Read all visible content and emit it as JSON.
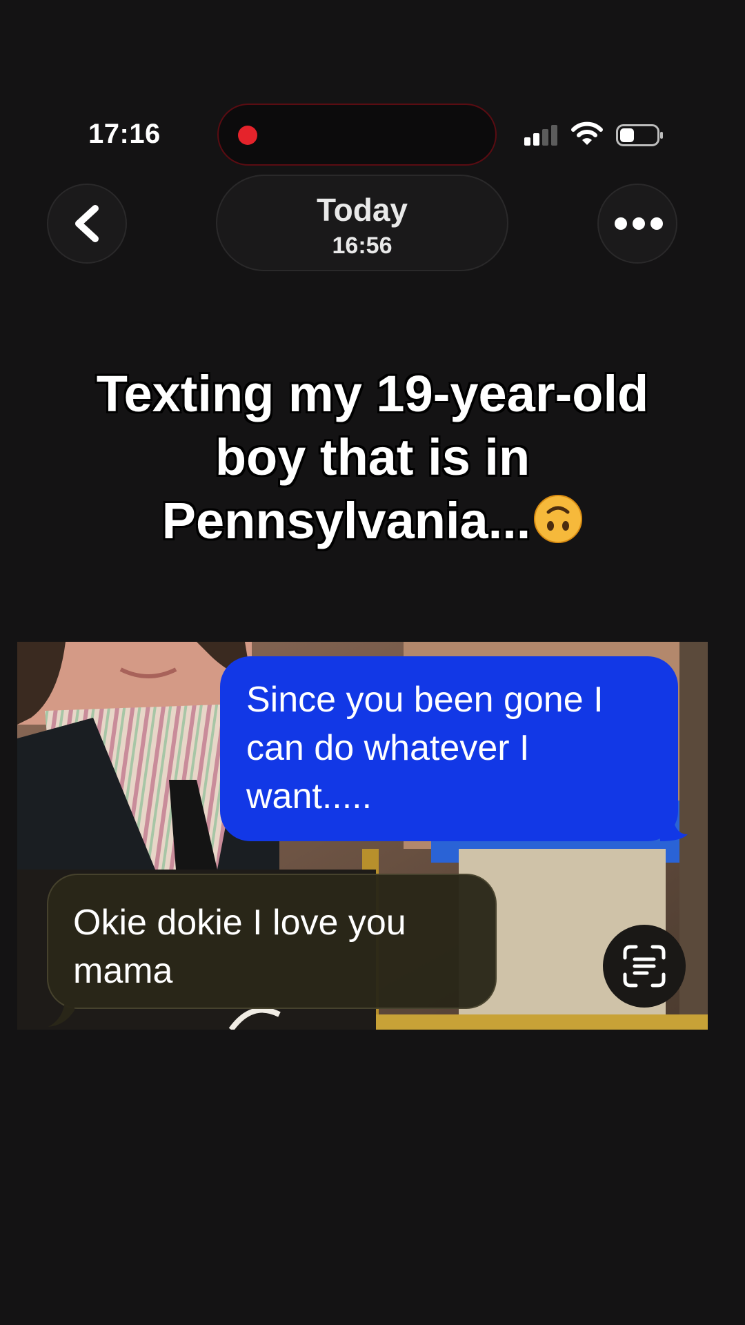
{
  "status_bar": {
    "time": "17:16",
    "recording_indicator_color": "#e5232b",
    "signal_icon": "cellular-signal-icon",
    "wifi_icon": "wifi-icon",
    "battery_icon": "battery-icon"
  },
  "header": {
    "back_icon": "chevron-left-icon",
    "date_label": "Today",
    "time_label": "16:56",
    "more_icon": "ellipsis-icon"
  },
  "caption": {
    "line1": "Texting my 19-year-old",
    "line2": "boy that is in",
    "line3": "Pennsylvania...",
    "emoji": "upside-down-face-emoji"
  },
  "screenshot": {
    "outgoing_message": "Since you been gone I can do whatever I want.....",
    "incoming_message": "Okie dokie I love you mama",
    "outgoing_color": "#1238e6",
    "live_text_icon": "live-text-scan-icon"
  }
}
